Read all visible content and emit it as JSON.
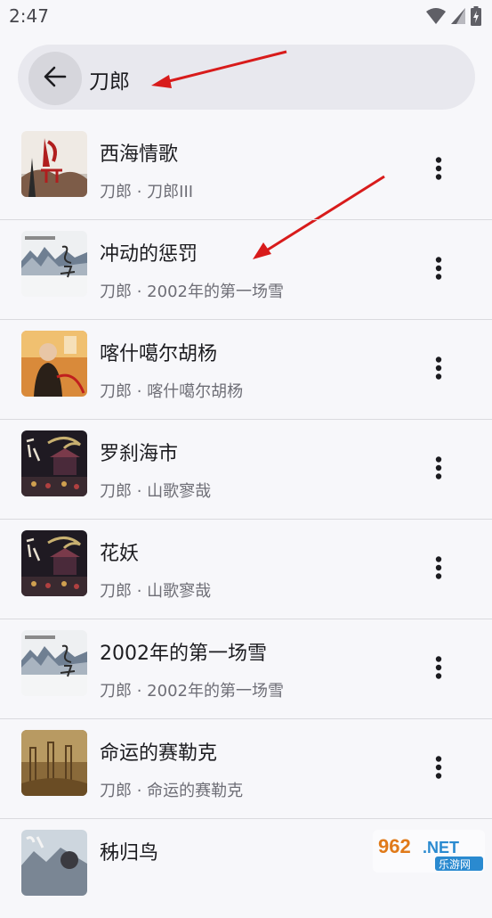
{
  "status_bar": {
    "time": "2:47",
    "icons": [
      "wifi-icon",
      "cellular-signal-icon",
      "battery-charging-icon"
    ]
  },
  "search": {
    "back_icon": "arrow-left-icon",
    "query": "刀郎"
  },
  "songs": [
    {
      "title": "西海情歌",
      "subtitle": "刀郎 · 刀郎III",
      "cover": "album-cover-daolang-iii"
    },
    {
      "title": "冲动的惩罚",
      "subtitle": "刀郎 · 2002年的第一场雪",
      "cover": "album-cover-first-snow"
    },
    {
      "title": "喀什噶尔胡杨",
      "subtitle": "刀郎 · 喀什噶尔胡杨",
      "cover": "album-cover-kashgar"
    },
    {
      "title": "罗刹海市",
      "subtitle": "刀郎 · 山歌寥哉",
      "cover": "album-cover-shange"
    },
    {
      "title": "花妖",
      "subtitle": "刀郎 · 山歌寥哉",
      "cover": "album-cover-shange"
    },
    {
      "title": "2002年的第一场雪",
      "subtitle": "刀郎 · 2002年的第一场雪",
      "cover": "album-cover-first-snow"
    },
    {
      "title": "命运的赛勒克",
      "subtitle": "刀郎 · 命运的赛勒克",
      "cover": "album-cover-sailek"
    },
    {
      "title": "秭归鸟",
      "subtitle": "",
      "cover": "album-cover-zigui"
    }
  ],
  "more_icon": "more-vertical-icon",
  "colors": {
    "background": "#f7f7fa",
    "search_bar": "#e8e8ee",
    "annotation_arrow": "#d81b1b",
    "divider": "#dadade"
  },
  "watermark": {
    "logo_text": "962.NET",
    "site_text": "乐游网"
  }
}
